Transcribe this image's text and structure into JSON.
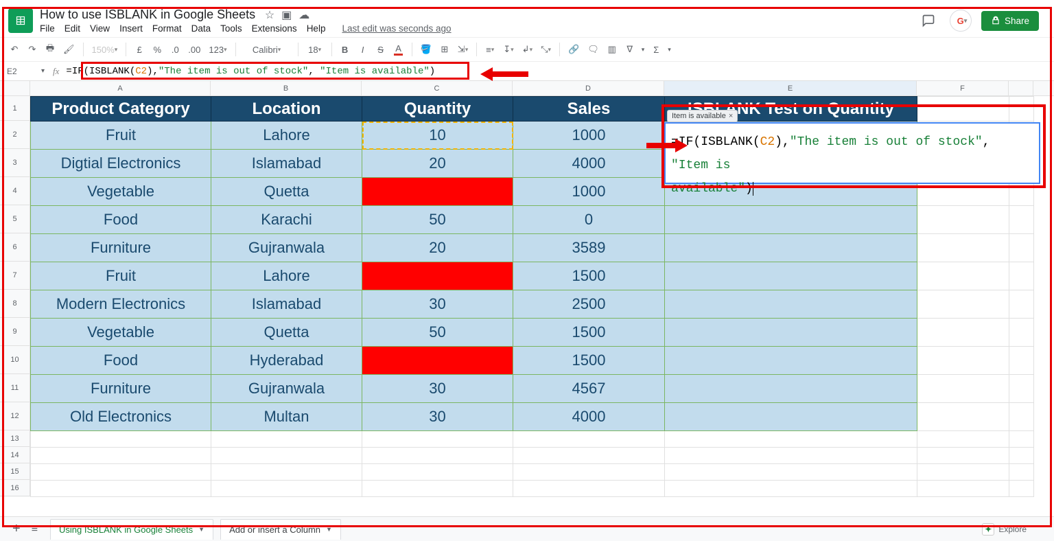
{
  "doc": {
    "title": "How to use ISBLANK in Google Sheets"
  },
  "menu": {
    "items": [
      "File",
      "Edit",
      "View",
      "Insert",
      "Format",
      "Data",
      "Tools",
      "Extensions",
      "Help"
    ],
    "last_edit": "Last edit was seconds ago"
  },
  "share": {
    "label": "Share"
  },
  "toolbar": {
    "zoom": "150%",
    "currency_symbol": "£",
    "percent": "%",
    "dec_dec": ".0",
    "dec_inc": ".00",
    "format_more": "123",
    "font_name": "Calibri",
    "font_size": "18"
  },
  "fx": {
    "cell_ref": "E2",
    "label": "fx",
    "pre": "=IF(ISBLANK(",
    "ref": "C2",
    "mid": "),",
    "str1": "\"The item is out of stock\"",
    "sep": ", ",
    "str2": "\"Item is available\"",
    "post": ")"
  },
  "columns": [
    "A",
    "B",
    "C",
    "D",
    "E",
    "F"
  ],
  "headers": {
    "A": "Product Category",
    "B": "Location",
    "C": "Quantity",
    "D": "Sales",
    "E": "ISBLANK Test on Quantity"
  },
  "rows": [
    {
      "A": "Fruit",
      "B": "Lahore",
      "C": "10",
      "D": "1000",
      "red": false
    },
    {
      "A": "Digtial Electronics",
      "B": "Islamabad",
      "C": "20",
      "D": "4000",
      "red": false
    },
    {
      "A": "Vegetable",
      "B": "Quetta",
      "C": "",
      "D": "1000",
      "red": true
    },
    {
      "A": "Food",
      "B": "Karachi",
      "C": "50",
      "D": "0",
      "red": false
    },
    {
      "A": "Furniture",
      "B": "Gujranwala",
      "C": "20",
      "D": "3589",
      "red": false
    },
    {
      "A": "Fruit",
      "B": "Lahore",
      "C": "",
      "D": "1500",
      "red": true
    },
    {
      "A": "Modern Electronics",
      "B": "Islamabad",
      "C": "30",
      "D": "2500",
      "red": false
    },
    {
      "A": "Vegetable",
      "B": "Quetta",
      "C": "50",
      "D": "1500",
      "red": false
    },
    {
      "A": "Food",
      "B": "Hyderabad",
      "C": "",
      "D": "1500",
      "red": true
    },
    {
      "A": "Furniture",
      "B": "Gujranwala",
      "C": "30",
      "D": "4567",
      "red": false
    },
    {
      "A": "Old Electronics",
      "B": "Multan",
      "C": "30",
      "D": "4000",
      "red": false
    }
  ],
  "row_numbers": [
    "1",
    "2",
    "3",
    "4",
    "5",
    "6",
    "7",
    "8",
    "9",
    "10",
    "11",
    "12",
    "13",
    "14",
    "15",
    "16"
  ],
  "preview": {
    "text": "Item is available",
    "close": "×"
  },
  "editor": {
    "line1_pre": "=IF(ISBLANK(",
    "line1_ref": "C2",
    "line1_mid": "),",
    "line1_str": "\"The item is out of stock\"",
    "line1_sep": ", ",
    "line1_str2": "\"Item is ",
    "line2_str": "available\"",
    "line2_post": ")"
  },
  "footer": {
    "tab_active": "Using ISBLANK in Google Sheets",
    "tab2": "Add or insert a Column",
    "explore": "Explore"
  }
}
